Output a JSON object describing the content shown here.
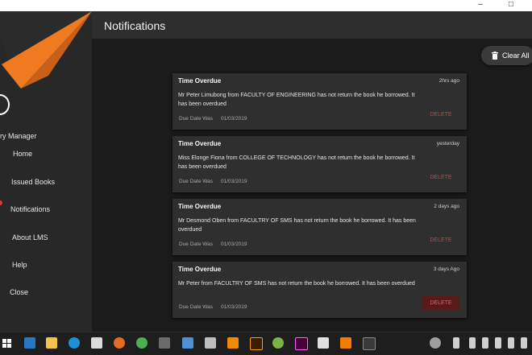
{
  "window": {
    "minimize": "–",
    "maximize": "□"
  },
  "sidebar": {
    "app_name": "ry Manager",
    "items": [
      {
        "label": "Home"
      },
      {
        "label": "Issued Books"
      },
      {
        "label": "Notifications",
        "active": true
      },
      {
        "label": "About LMS"
      },
      {
        "label": "Help"
      },
      {
        "label": "Close"
      }
    ]
  },
  "header": {
    "title": "Notifications"
  },
  "toolbar": {
    "clear_all_label": "Clear All"
  },
  "notifications": [
    {
      "title": "Time Overdue",
      "time": "2hrs ago",
      "message": "Mr Peter Limubong from FACULTY OF ENGINEERING has not return the book he borrowed.  It has been overdued",
      "due_label": "Due Date Was",
      "due_date": "01/03/2019",
      "delete_label": "DELETE"
    },
    {
      "title": "Time Overdue",
      "time": "yesterday",
      "message": "Miss Elonge Fiona from COLLEGE OF TECHNOLOGY has not return the book he borrowed.  It has been overdued",
      "due_label": "Due Date Was",
      "due_date": "01/03/2019",
      "delete_label": "DELETE"
    },
    {
      "title": "Time Overdue",
      "time": "2 days ago",
      "message": "Mr Desmond Oben from FACULTRY OF SMS has not return the book he borrowed.  It has been overdued",
      "due_label": "Due Date Was",
      "due_date": "01/03/2019",
      "delete_label": "DELETE"
    },
    {
      "title": "Time Overdue",
      "time": "3 days Ago",
      "message": "Mr Peter from FACULTRY OF SMS has not return the book he borrowed.  It has been overdued",
      "due_label": "Due Date Was",
      "due_date": "01/03/2019",
      "delete_label": "DELETE"
    }
  ],
  "colors": {
    "accent": "#e87722",
    "delete": "#e53935"
  },
  "taskbar": {
    "icons": [
      "start-icon",
      "vscode-icon",
      "file-explorer-icon",
      "edge-icon",
      "store-icon",
      "firefox-icon",
      "chrome-icon",
      "snipping-icon",
      "box-icon",
      "printer-icon",
      "vlc-icon",
      "illustrator-icon",
      "android-icon",
      "xd-icon",
      "notepad-icon",
      "app-g-icon",
      "active-app-icon"
    ]
  }
}
